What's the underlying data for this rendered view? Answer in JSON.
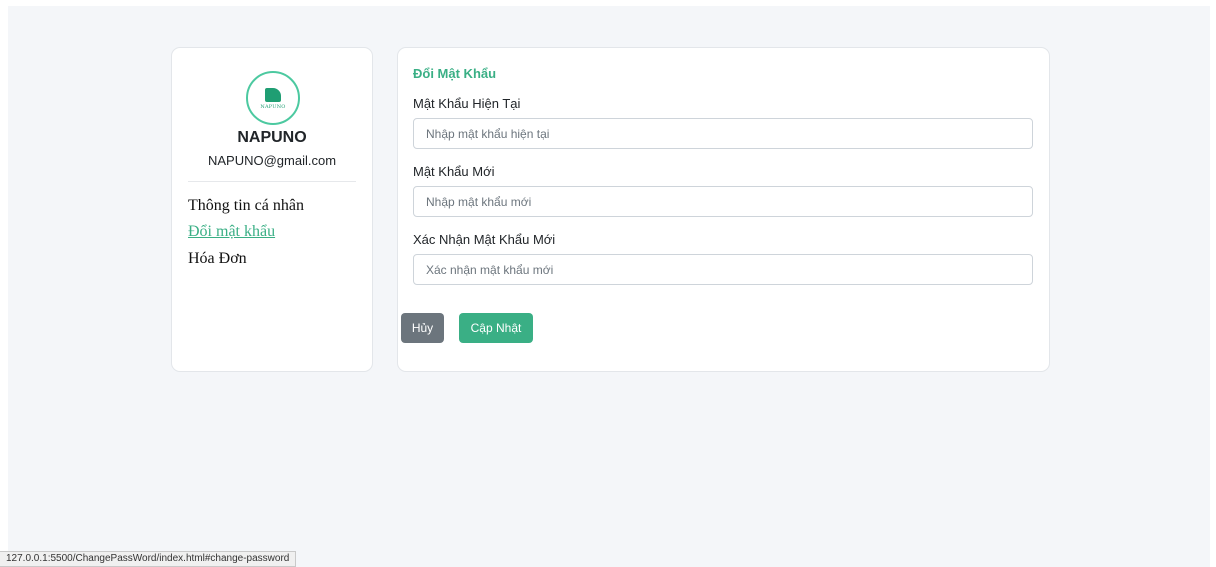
{
  "profile": {
    "logo_text": "NAPUNO",
    "name": "NAPUNO",
    "email": "NAPUNO@gmail.com",
    "nav": [
      {
        "label": "Thông tin cá nhân",
        "active": false
      },
      {
        "label": "Đổi mật khẩu",
        "active": true
      },
      {
        "label": "Hóa Đơn",
        "active": false
      }
    ]
  },
  "form": {
    "title": "Đổi Mật Khẩu",
    "fields": [
      {
        "label": "Mật Khẩu Hiện Tại",
        "placeholder": "Nhập mật khẩu hiện tại",
        "value": ""
      },
      {
        "label": "Mật Khẩu Mới",
        "placeholder": "Nhập mật khẩu mới",
        "value": ""
      },
      {
        "label": "Xác Nhận Mật Khẩu Mới",
        "placeholder": "Xác nhận mật khẩu mới",
        "value": ""
      }
    ],
    "cancel_label": "Hủy",
    "update_label": "Cập Nhật"
  },
  "status_bar": {
    "url": "127.0.0.1:5500/ChangePassWord/index.html#change-password"
  },
  "colors": {
    "accent": "#3aaf85",
    "cancel": "#6c757d",
    "background": "#f4f6f9"
  }
}
